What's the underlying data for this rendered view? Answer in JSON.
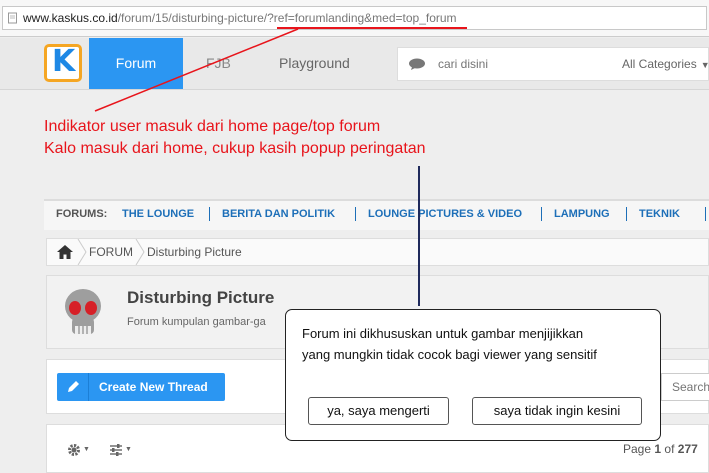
{
  "browser": {
    "url_domain": "www.kaskus.co.id",
    "url_path": "/forum/15/disturbing-picture/",
    "url_query": "?ref=forumlanding&med=top_forum"
  },
  "header": {
    "logo_letter": "K",
    "nav_forum": "Forum",
    "nav_fjb": "FJB",
    "nav_playground": "Playground",
    "search_placeholder": "cari disini",
    "category_selected": "All Categories"
  },
  "annotations": {
    "line1": "Indikator user masuk dari home page/top forum",
    "line2": "Kalo masuk dari home, cukup kasih popup peringatan"
  },
  "forum_nav": {
    "label": "FORUMS:",
    "items": [
      "THE LOUNGE",
      "BERITA DAN POLITIK",
      "LOUNGE PICTURES & VIDEO",
      "LAMPUNG",
      "TEKNIK"
    ]
  },
  "breadcrumb": {
    "forum": "FORUM",
    "current": "Disturbing Picture"
  },
  "forum_info": {
    "title": "Disturbing Picture",
    "description": "Forum kumpulan gambar-ga"
  },
  "toolbar": {
    "create_thread": "Create New Thread",
    "search_placeholder": "Search"
  },
  "listing": {
    "page_prefix": "Page",
    "page_current": "1",
    "page_of": "of",
    "page_total": "277"
  },
  "popup": {
    "message_line1": "Forum ini dikhususkan untuk gambar menjijikkan",
    "message_line2": "yang mungkin tidak cocok bagi viewer yang sensitif",
    "confirm_label": "ya, saya mengerti",
    "decline_label": "saya tidak ingin kesini"
  },
  "colors": {
    "accent_blue": "#2b96f2",
    "annotation_red": "#e8141b",
    "link_blue": "#1d6fb8",
    "logo_orange": "#f5a623"
  }
}
